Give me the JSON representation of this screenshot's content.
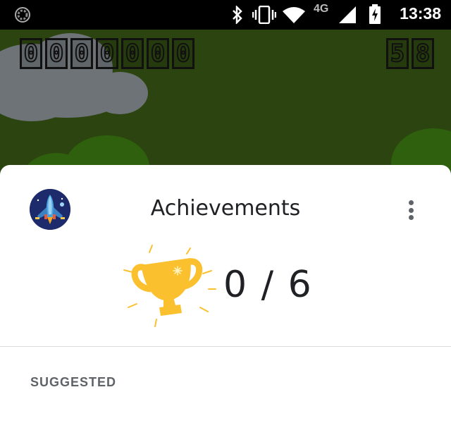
{
  "status_bar": {
    "time": "13:38",
    "network": "4G",
    "icons": [
      "loading-icon",
      "bluetooth-icon",
      "vibrate-icon",
      "wifi-icon",
      "cell-signal-icon",
      "battery-charging-icon"
    ]
  },
  "game": {
    "score_digits": [
      "0",
      "0",
      "0",
      "0",
      "0",
      "0",
      "0"
    ],
    "timer_digits": [
      "5",
      "8"
    ]
  },
  "sheet": {
    "title": "Achievements",
    "achievements_count": "0 / 6",
    "section_label": "SUGGESTED",
    "accent_color": "#fbc02d"
  }
}
